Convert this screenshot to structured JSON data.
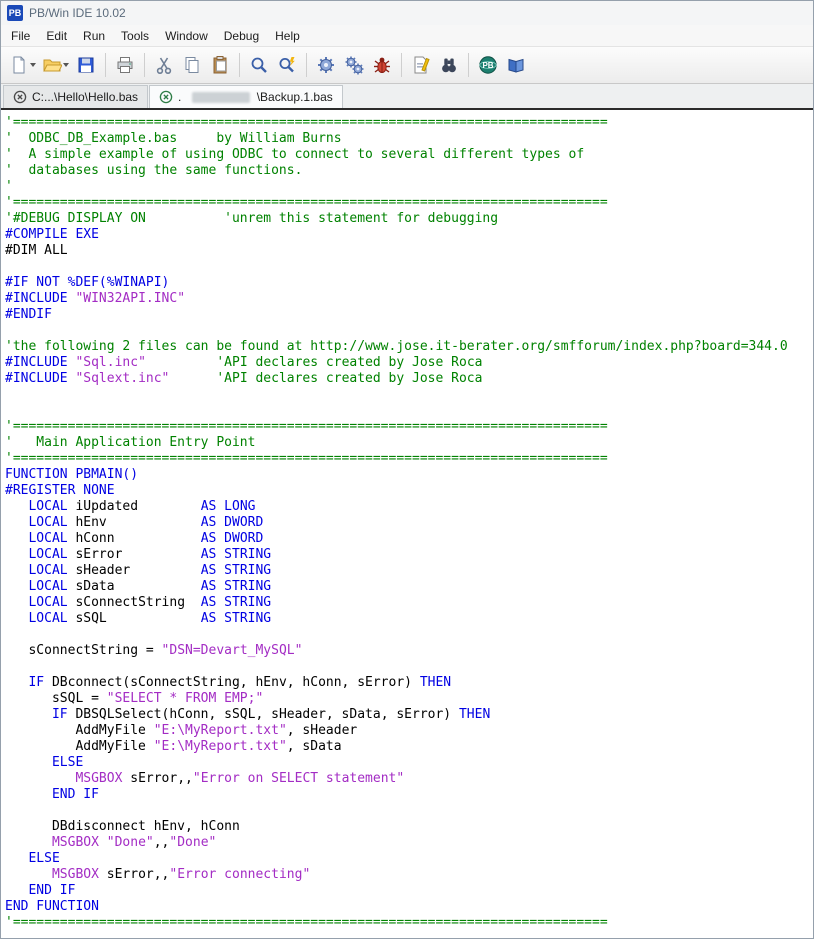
{
  "window": {
    "title": "PB/Win IDE 10.02",
    "logo_text": "PB"
  },
  "menu": {
    "items": [
      "File",
      "Edit",
      "Run",
      "Tools",
      "Window",
      "Debug",
      "Help"
    ]
  },
  "toolbar": {
    "buttons": [
      "new-file",
      "open-file",
      "save-file",
      "print",
      "cut",
      "copy",
      "paste",
      "find",
      "find-again",
      "compile",
      "compile-all",
      "compile-and-debug",
      "view-compile-results",
      "find-in-files",
      "powerbasic-web",
      "help-book"
    ]
  },
  "tabs": [
    {
      "label": "C:...\\Hello\\Hello.bas"
    },
    {
      "prefix": ". ",
      "suffix": "\\Backup.1.bas",
      "redacted": true
    }
  ],
  "colors": {
    "comment": "#008200",
    "keyword": "#0000e3",
    "string": "#a32cc4",
    "msgbox": "#a32cc4",
    "plain": "#000000",
    "accent_blue": "#1a49b8"
  },
  "editor": {
    "lines": [
      [
        [
          "'============================================================================",
          "cm"
        ]
      ],
      [
        [
          "'  ODBC_DB_Example.bas     by William Burns",
          "cm"
        ]
      ],
      [
        [
          "'  A simple example of using ODBC to connect to several different types of",
          "cm"
        ]
      ],
      [
        [
          "'  databases using the same functions.",
          "cm"
        ]
      ],
      [
        [
          "'",
          "cm"
        ]
      ],
      [
        [
          "'============================================================================",
          "cm"
        ]
      ],
      [
        [
          "'#DEBUG DISPLAY ON          'unrem this statement for debugging",
          "cm"
        ]
      ],
      [
        [
          "#COMPILE EXE",
          "kw"
        ]
      ],
      [
        [
          "#DIM ALL",
          "pl"
        ]
      ],
      [],
      [
        [
          "#IF NOT %DEF(%WINAPI)",
          "kw"
        ]
      ],
      [
        [
          "#INCLUDE ",
          "kw"
        ],
        [
          "\"WIN32API.INC\"",
          "st"
        ]
      ],
      [
        [
          "#ENDIF",
          "kw"
        ]
      ],
      [],
      [
        [
          "'the following 2 files can be found at http://www.jose.it-berater.org/smfforum/index.php?board=344.0",
          "cm"
        ]
      ],
      [
        [
          "#INCLUDE ",
          "kw"
        ],
        [
          "\"Sql.inc\"",
          "st"
        ],
        [
          "         ",
          "pl"
        ],
        [
          "'API declares created by Jose Roca",
          "cm"
        ]
      ],
      [
        [
          "#INCLUDE ",
          "kw"
        ],
        [
          "\"Sqlext.inc\"",
          "st"
        ],
        [
          "      ",
          "pl"
        ],
        [
          "'API declares created by Jose Roca",
          "cm"
        ]
      ],
      [],
      [],
      [
        [
          "'============================================================================",
          "cm"
        ]
      ],
      [
        [
          "'   Main Application Entry Point",
          "cm"
        ]
      ],
      [
        [
          "'============================================================================",
          "cm"
        ]
      ],
      [
        [
          "FUNCTION PBMAIN()",
          "kw"
        ]
      ],
      [
        [
          "#REGISTER NONE",
          "kw"
        ]
      ],
      [
        [
          "   ",
          "pl"
        ],
        [
          "LOCAL",
          "kw"
        ],
        [
          " iUpdated        ",
          "pl"
        ],
        [
          "AS LONG",
          "kw"
        ]
      ],
      [
        [
          "   ",
          "pl"
        ],
        [
          "LOCAL",
          "kw"
        ],
        [
          " hEnv            ",
          "pl"
        ],
        [
          "AS DWORD",
          "kw"
        ]
      ],
      [
        [
          "   ",
          "pl"
        ],
        [
          "LOCAL",
          "kw"
        ],
        [
          " hConn           ",
          "pl"
        ],
        [
          "AS DWORD",
          "kw"
        ]
      ],
      [
        [
          "   ",
          "pl"
        ],
        [
          "LOCAL",
          "kw"
        ],
        [
          " sError          ",
          "pl"
        ],
        [
          "AS STRING",
          "kw"
        ]
      ],
      [
        [
          "   ",
          "pl"
        ],
        [
          "LOCAL",
          "kw"
        ],
        [
          " sHeader         ",
          "pl"
        ],
        [
          "AS STRING",
          "kw"
        ]
      ],
      [
        [
          "   ",
          "pl"
        ],
        [
          "LOCAL",
          "kw"
        ],
        [
          " sData           ",
          "pl"
        ],
        [
          "AS STRING",
          "kw"
        ]
      ],
      [
        [
          "   ",
          "pl"
        ],
        [
          "LOCAL",
          "kw"
        ],
        [
          " sConnectString  ",
          "pl"
        ],
        [
          "AS STRING",
          "kw"
        ]
      ],
      [
        [
          "   ",
          "pl"
        ],
        [
          "LOCAL",
          "kw"
        ],
        [
          " sSQL            ",
          "pl"
        ],
        [
          "AS STRING",
          "kw"
        ]
      ],
      [],
      [
        [
          "   sConnectString = ",
          "pl"
        ],
        [
          "\"DSN=Devart_MySQL\"",
          "st"
        ]
      ],
      [],
      [
        [
          "   ",
          "pl"
        ],
        [
          "IF",
          "kw"
        ],
        [
          " DBconnect(sConnectString, hEnv, hConn, sError) ",
          "pl"
        ],
        [
          "THEN",
          "kw"
        ]
      ],
      [
        [
          "      sSQL = ",
          "pl"
        ],
        [
          "\"SELECT * FROM EMP;\"",
          "st"
        ]
      ],
      [
        [
          "      ",
          "pl"
        ],
        [
          "IF",
          "kw"
        ],
        [
          " DBSQLSelect(hConn, sSQL, sHeader, sData, sError) ",
          "pl"
        ],
        [
          "THEN",
          "kw"
        ]
      ],
      [
        [
          "         AddMyFile ",
          "pl"
        ],
        [
          "\"E:\\MyReport.txt\"",
          "st"
        ],
        [
          ", sHeader",
          "pl"
        ]
      ],
      [
        [
          "         AddMyFile ",
          "pl"
        ],
        [
          "\"E:\\MyReport.txt\"",
          "st"
        ],
        [
          ", sData",
          "pl"
        ]
      ],
      [
        [
          "      ",
          "pl"
        ],
        [
          "ELSE",
          "kw"
        ]
      ],
      [
        [
          "         ",
          "pl"
        ],
        [
          "MSGBOX",
          "ms"
        ],
        [
          " sError,,",
          "pl"
        ],
        [
          "\"Error on SELECT statement\"",
          "st"
        ]
      ],
      [
        [
          "      ",
          "pl"
        ],
        [
          "END IF",
          "kw"
        ]
      ],
      [],
      [
        [
          "      DBdisconnect hEnv, hConn",
          "pl"
        ]
      ],
      [
        [
          "      ",
          "pl"
        ],
        [
          "MSGBOX",
          "ms"
        ],
        [
          " ",
          "pl"
        ],
        [
          "\"Done\"",
          "st"
        ],
        [
          ",,",
          "pl"
        ],
        [
          "\"Done\"",
          "st"
        ]
      ],
      [
        [
          "   ",
          "pl"
        ],
        [
          "ELSE",
          "kw"
        ]
      ],
      [
        [
          "      ",
          "pl"
        ],
        [
          "MSGBOX",
          "ms"
        ],
        [
          " sError,,",
          "pl"
        ],
        [
          "\"Error connecting\"",
          "st"
        ]
      ],
      [
        [
          "   ",
          "pl"
        ],
        [
          "END IF",
          "kw"
        ]
      ],
      [
        [
          "END FUNCTION",
          "kw"
        ]
      ],
      [
        [
          "'============================================================================",
          "cm"
        ]
      ]
    ]
  }
}
